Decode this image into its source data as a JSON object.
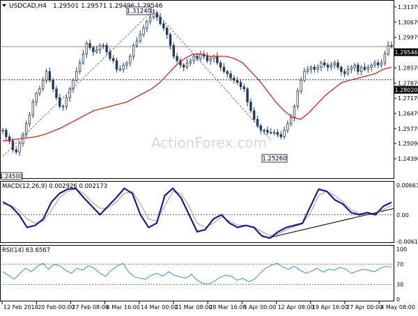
{
  "header": {
    "symbol_label": "USDCAD,H4",
    "ohlc_label": "1.29501 1.29571 1.29496 1.29546"
  },
  "watermark": "ActionForex.com",
  "colors": {
    "candles": "#1f3b66",
    "sma": "#d81e1e",
    "macd": "#1a1a8c",
    "signal": "#9a9a9a",
    "rsi": "#3a8fdc",
    "grid": "#666666",
    "axis": "#000000"
  },
  "chart_data": [
    {
      "type": "candlestick",
      "panel": "price",
      "symbol": "USDCAD",
      "timeframe": "H4",
      "last_price": 1.29546,
      "ylim": [
        1.2439,
        1.3137
      ],
      "y_ticks": [
        1.3137,
        1.3067,
        1.2997,
        1.2927,
        1.2857,
        1.2787,
        1.2717,
        1.2647,
        1.2577,
        1.2509,
        1.2439
      ],
      "y_tick_labels": [
        "1.31370",
        "1.30670",
        "1.29970",
        "1.29270",
        "1.28570",
        "1.27870",
        "1.27170",
        "1.26470",
        "1.25770",
        "1.25090",
        "1.24390"
      ],
      "x_tick_labels": [
        "12 Feb 2018",
        "20 Feb 00:00",
        "27 Feb 08:00",
        "6 Mar 16:00",
        "14 Mar 00:00",
        "21 Mar 08:00",
        "28 Mar 16:00",
        "5 Apr 00:00",
        "12 Apr 08:00",
        "19 Apr 16:00",
        "27 Apr 00:00",
        "4 May 08:00"
      ],
      "horizontal_levels": [
        {
          "value": 1.29546,
          "label": "1.29546",
          "style": "solid"
        },
        {
          "value": 1.2802,
          "label": "1.28020",
          "style": "dotted"
        }
      ],
      "annotations": [
        {
          "text": "1.31240",
          "value": 1.3124
        },
        {
          "text": "1.25260",
          "value": 1.2526
        },
        {
          "text": "1.24500",
          "value": 1.245
        }
      ],
      "close_path": [
        1.257,
        1.254,
        1.252,
        1.248,
        1.247,
        1.251,
        1.255,
        1.26,
        1.264,
        1.27,
        1.274,
        1.276,
        1.28,
        1.284,
        1.28,
        1.276,
        1.272,
        1.268,
        1.268,
        1.272,
        1.276,
        1.28,
        1.284,
        1.288,
        1.292,
        1.297,
        1.295,
        1.293,
        1.294,
        1.296,
        1.296,
        1.293,
        1.29,
        1.289,
        1.285,
        1.285,
        1.287,
        1.288,
        1.291,
        1.296,
        1.298,
        1.301,
        1.304,
        1.307,
        1.309,
        1.311,
        1.309,
        1.306,
        1.304,
        1.301,
        1.296,
        1.291,
        1.289,
        1.287,
        1.286,
        1.288,
        1.289,
        1.291,
        1.29,
        1.292,
        1.291,
        1.289,
        1.29,
        1.291,
        1.288,
        1.286,
        1.284,
        1.283,
        1.281,
        1.28,
        1.279,
        1.277,
        1.276,
        1.27,
        1.266,
        1.262,
        1.259,
        1.257,
        1.257,
        1.256,
        1.256,
        1.256,
        1.255,
        1.254,
        1.257,
        1.26,
        1.263,
        1.268,
        1.275,
        1.28,
        1.284,
        1.285,
        1.286,
        1.285,
        1.286,
        1.288,
        1.287,
        1.286,
        1.287,
        1.288,
        1.286,
        1.284,
        1.283,
        1.285,
        1.286,
        1.287,
        1.284,
        1.286,
        1.285,
        1.286,
        1.287,
        1.288,
        1.287,
        1.288,
        1.292,
        1.296,
        1.2955
      ],
      "series": [
        {
          "name": "",
          "indicator": "moving_average",
          "values": [
            1.252,
            1.2525,
            1.253,
            1.2535,
            1.254,
            1.255,
            1.2565,
            1.258,
            1.26,
            1.262,
            1.264,
            1.266,
            1.267,
            1.268,
            1.269,
            1.27,
            1.272,
            1.274,
            1.276,
            1.279,
            1.283,
            1.287,
            1.29,
            1.292,
            1.292,
            1.291,
            1.291,
            1.291,
            1.29,
            1.288,
            1.284,
            1.28,
            1.275,
            1.27,
            1.266,
            1.263,
            1.262,
            1.265,
            1.269,
            1.273,
            1.276,
            1.279,
            1.28,
            1.281,
            1.282,
            1.283,
            1.285,
            1.286
          ]
        }
      ]
    },
    {
      "type": "line",
      "panel": "indicator",
      "title": "MACD(12,26,9) 0.002926 0.002173",
      "ylim": [
        -0.00614,
        0.00663
      ],
      "y_tick_labels": [
        "0.006639",
        "0.00",
        "-0.006114"
      ],
      "reference_lines": [
        {
          "value": 0.0,
          "style": "dotted"
        }
      ],
      "trendline": {
        "from": -0.0055,
        "to": 0.0015
      },
      "series": [
        {
          "name": "",
          "role": "main",
          "values": [
            0.003,
            0.002,
            0.0,
            -0.003,
            -0.0025,
            -0.001,
            0.003,
            0.005,
            0.006,
            0.0062,
            0.004,
            0.002,
            0.0,
            0.002,
            0.004,
            0.0062,
            0.005,
            0.0,
            -0.003,
            -0.002,
            0.0045,
            0.0062,
            0.004,
            0.0,
            -0.004,
            -0.0035,
            -0.001,
            0.0,
            -0.002,
            -0.003,
            -0.0025,
            -0.003,
            -0.005,
            -0.0055,
            -0.004,
            -0.003,
            -0.0025,
            -0.002,
            0.002,
            0.006,
            0.0055,
            0.0035,
            0.0025,
            0.0005,
            0.0,
            0.0005,
            0.0,
            0.002,
            0.0029
          ]
        },
        {
          "name": "",
          "role": "signal",
          "values": [
            0.0025,
            0.0022,
            0.001,
            -0.001,
            -0.002,
            -0.0015,
            0.001,
            0.004,
            0.0055,
            0.006,
            0.005,
            0.003,
            0.0015,
            0.0015,
            0.003,
            0.005,
            0.0055,
            0.0025,
            -0.001,
            -0.0015,
            0.002,
            0.0055,
            0.005,
            0.002,
            -0.002,
            -0.003,
            -0.002,
            -0.0005,
            -0.0015,
            -0.0025,
            -0.0025,
            -0.0028,
            -0.004,
            -0.005,
            -0.0045,
            -0.0035,
            -0.0028,
            -0.0022,
            0.0005,
            0.0045,
            0.0055,
            0.0045,
            0.003,
            0.0012,
            0.0003,
            0.0003,
            0.0002,
            0.0012,
            0.0022
          ]
        }
      ]
    },
    {
      "type": "line",
      "panel": "indicator",
      "title": "RSI(14) 63.6567",
      "ylim": [
        0,
        100
      ],
      "y_ticks": [
        100,
        70,
        30,
        0
      ],
      "y_tick_labels": [
        "100",
        "70",
        "30",
        "0"
      ],
      "reference_lines": [
        {
          "value": 70,
          "style": "dotted"
        },
        {
          "value": 30,
          "style": "dotted"
        }
      ],
      "series": [
        {
          "name": "",
          "values": [
            55,
            48,
            40,
            52,
            62,
            55,
            65,
            72,
            60,
            70,
            66,
            58,
            52,
            62,
            58,
            67,
            62,
            52,
            46,
            58,
            66,
            72,
            55,
            45,
            42,
            40,
            48,
            52,
            46,
            55,
            48,
            45,
            42,
            50,
            38,
            32,
            30,
            36,
            44,
            48,
            46,
            38,
            42,
            35,
            40,
            52,
            62,
            68,
            72,
            64,
            60,
            66,
            58,
            52,
            56,
            62,
            54,
            60,
            58,
            64,
            60,
            52,
            56,
            60,
            58,
            55,
            62,
            66,
            64
          ]
        }
      ]
    }
  ]
}
